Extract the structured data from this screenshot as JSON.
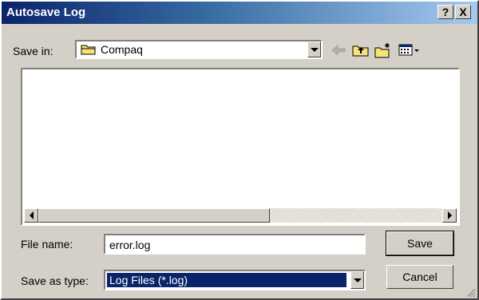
{
  "window": {
    "title": "Autosave Log",
    "help_label": "?",
    "close_label": "X"
  },
  "save_in": {
    "label": "Save in:",
    "value": "Compaq",
    "icon": "folder-icon"
  },
  "toolbar": {
    "icons": [
      "back-arrow-icon",
      "up-folder-icon",
      "new-folder-icon",
      "view-menu-icon"
    ]
  },
  "file_list": {
    "items": []
  },
  "file_name": {
    "label": "File name:",
    "value": "error.log"
  },
  "save_as_type": {
    "label": "Save as type:",
    "value": "Log Files (*.log)"
  },
  "buttons": {
    "save": "Save",
    "cancel": "Cancel"
  },
  "colors": {
    "title_start": "#0a246a",
    "title_end": "#a6caf0",
    "selection": "#0a246a",
    "face": "#d4d0c8"
  }
}
